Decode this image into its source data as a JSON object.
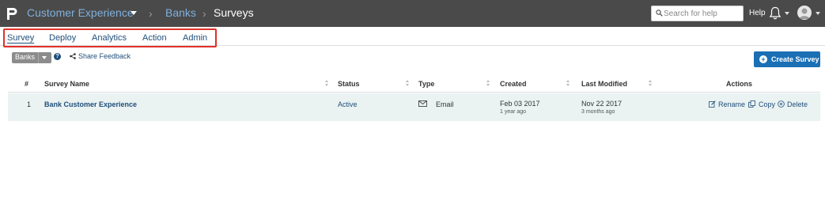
{
  "header": {
    "breadcrumb": [
      {
        "label": "Customer Experience"
      },
      {
        "label": "Banks"
      },
      {
        "label": "Surveys"
      }
    ],
    "search": {
      "placeholder": "Search for help"
    },
    "help_label": "Help"
  },
  "nav": {
    "tabs": [
      {
        "label": "Survey",
        "active": true
      },
      {
        "label": "Deploy"
      },
      {
        "label": "Analytics"
      },
      {
        "label": "Action"
      },
      {
        "label": "Admin"
      }
    ]
  },
  "toolbar": {
    "folder_label": "Banks",
    "help_glyph": "?",
    "share_feedback": "Share Feedback",
    "create_label": "Create Survey",
    "create_glyph": "+"
  },
  "table": {
    "columns": [
      "#",
      "Survey Name",
      "Status",
      "Type",
      "Created",
      "Last Modified",
      "Actions"
    ],
    "rows": [
      {
        "num": "1",
        "name": "Bank Customer Experience",
        "status": "Active",
        "type": "Email",
        "created": "Feb 03 2017",
        "created_ago": "1 year ago",
        "modified": "Nov 22 2017",
        "modified_ago": "3 months ago",
        "actions": [
          "Rename",
          "Copy",
          "Delete"
        ]
      }
    ]
  },
  "colors": {
    "topbar": "#4a4a4a",
    "link": "#1f4e7a",
    "accent": "#1a6fb5",
    "highlight": "#e0312a",
    "row_bg": "#eaf2f2"
  },
  "icons": [
    "logo-icon",
    "search-icon",
    "bell-icon",
    "avatar-icon",
    "help-icon",
    "share-icon",
    "plus-icon",
    "email-icon",
    "edit-icon",
    "copy-icon",
    "delete-icon",
    "sort-icon"
  ]
}
